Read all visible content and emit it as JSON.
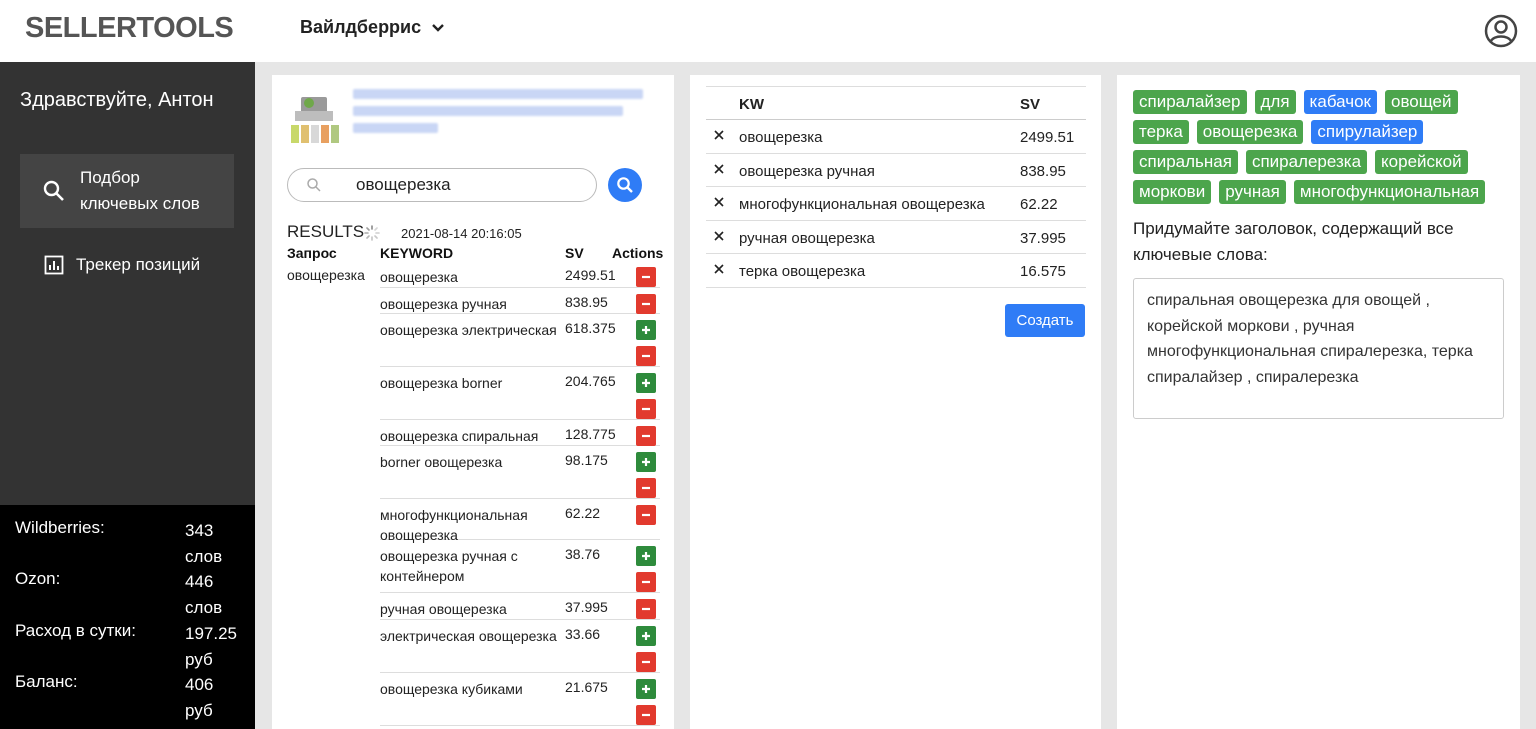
{
  "header": {
    "logo": "SELLERTOOLS",
    "marketplace": "Вайлдберрис"
  },
  "sidebar": {
    "greeting": "Здравствуйте, Антон",
    "nav": [
      {
        "label": "Подбор ключевых слов",
        "icon": "search-icon",
        "active": true
      },
      {
        "label": "Трекер позиций",
        "icon": "chart-icon",
        "active": false
      }
    ],
    "stats": [
      {
        "label": "Wildberries:",
        "value": "343 слов"
      },
      {
        "label": "Ozon:",
        "value": "446 слов"
      },
      {
        "label": "Расход в сутки:",
        "value": "197.25 руб"
      },
      {
        "label": "Баланс:",
        "value": "406 руб"
      }
    ]
  },
  "search": {
    "query": "овощерезка",
    "results_label": "RESULTS",
    "results_date": "2021-08-14 20:16:05",
    "columns": [
      "Запрос",
      "KEYWORD",
      "SV",
      "Actions"
    ],
    "query_cell": "овощерезка",
    "rows": [
      {
        "keyword": "овощерезка",
        "sv": "2499.51",
        "actions": [
          "remove"
        ]
      },
      {
        "keyword": "овощерезка ручная",
        "sv": "838.95",
        "actions": [
          "remove"
        ]
      },
      {
        "keyword": "овощерезка электрическая",
        "sv": "618.375",
        "actions": [
          "add",
          "remove"
        ]
      },
      {
        "keyword": "овощерезка borner",
        "sv": "204.765",
        "actions": [
          "add",
          "remove"
        ]
      },
      {
        "keyword": "овощерезка спиральная",
        "sv": "128.775",
        "actions": [
          "remove"
        ]
      },
      {
        "keyword": "borner овощерезка",
        "sv": "98.175",
        "actions": [
          "add",
          "remove"
        ]
      },
      {
        "keyword": "многофункциональная овощерезка",
        "sv": "62.22",
        "actions": [
          "remove"
        ]
      },
      {
        "keyword": "овощерезка ручная с контейнером",
        "sv": "38.76",
        "actions": [
          "add",
          "remove"
        ]
      },
      {
        "keyword": "ручная овощерезка",
        "sv": "37.995",
        "actions": [
          "remove"
        ]
      },
      {
        "keyword": "электрическая овощерезка",
        "sv": "33.66",
        "actions": [
          "add",
          "remove"
        ]
      },
      {
        "keyword": "овощерезка кубиками",
        "sv": "21.675",
        "actions": [
          "add",
          "remove"
        ]
      }
    ]
  },
  "selected": {
    "columns": [
      "KW",
      "SV"
    ],
    "rows": [
      {
        "kw": "овощерезка",
        "sv": "2499.51"
      },
      {
        "kw": "овощерезка ручная",
        "sv": "838.95"
      },
      {
        "kw": "многофункциональная овощерезка",
        "sv": "62.22"
      },
      {
        "kw": "ручная овощерезка",
        "sv": "37.995"
      },
      {
        "kw": "терка овощерезка",
        "sv": "16.575"
      }
    ],
    "create_label": "Создать"
  },
  "title_builder": {
    "chips": [
      {
        "text": "спиралайзер",
        "color": "#4ca54c"
      },
      {
        "text": "для",
        "color": "#4ca54c"
      },
      {
        "text": "кабачок",
        "color": "#2f7cf6"
      },
      {
        "text": "овощей",
        "color": "#4ca54c"
      },
      {
        "text": "терка",
        "color": "#4ca54c"
      },
      {
        "text": "овощерезка",
        "color": "#4ca54c"
      },
      {
        "text": "спирулайзер",
        "color": "#2f7cf6"
      },
      {
        "text": "спиральная",
        "color": "#4ca54c"
      },
      {
        "text": "спиралерезка",
        "color": "#4ca54c"
      },
      {
        "text": "корейской",
        "color": "#4ca54c"
      },
      {
        "text": "моркови",
        "color": "#4ca54c"
      },
      {
        "text": "ручная",
        "color": "#4ca54c"
      },
      {
        "text": "многофункциональная",
        "color": "#4ca54c"
      }
    ],
    "prompt": "Придумайте заголовок, содержащий все ключевые слова:",
    "title_value": "спиральная овощерезка для овощей , корейской моркови , ручная многофункциональная спиралерезка, терка спиралайзер , спиралерезка"
  }
}
